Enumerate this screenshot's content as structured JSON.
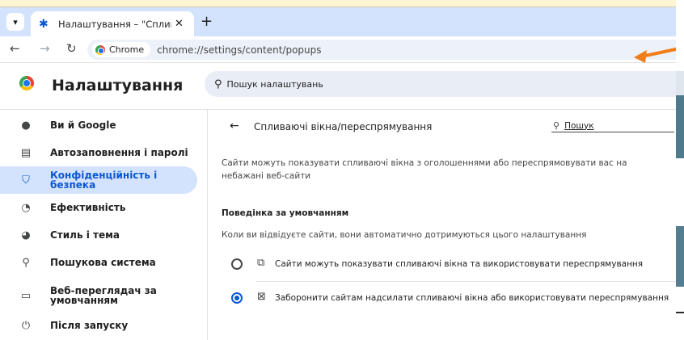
{
  "browser": {
    "tab_title": "Налаштування – \"Спливаючі в",
    "new_tab": "+",
    "chrome_chip": "Chrome",
    "url": "chrome://settings/content/popups"
  },
  "header": {
    "title": "Налаштування",
    "search_placeholder": "Пошук налаштувань"
  },
  "sidebar": {
    "items": [
      {
        "label": "Ви й Google",
        "icon": "person-icon"
      },
      {
        "label": "Автозаповнення і паролі",
        "icon": "clipboard-icon"
      },
      {
        "label": "Конфіденційність і безпека",
        "icon": "shield-icon",
        "active": true
      },
      {
        "label": "Ефективність",
        "icon": "speedometer-icon"
      },
      {
        "label": "Стиль і тема",
        "icon": "palette-icon"
      },
      {
        "label": "Пошукова система",
        "icon": "search-icon"
      },
      {
        "label": "Веб-переглядач за умовчанням",
        "icon": "browser-icon"
      },
      {
        "label": "Після запуску",
        "icon": "power-icon"
      }
    ]
  },
  "main": {
    "title": "Спливаючі вікна/переспрямування",
    "search_label": "Пошук",
    "description": "Сайти можуть показувати спливаючі вікна з оголошеннями або переспрямовувати вас на небажані веб-сайти",
    "section_title": "Поведінка за умовчанням",
    "section_note": "Коли ви відвідуєте сайти, вони автоматично дотримуються цього налаштування",
    "options": [
      {
        "label": "Сайти можуть показувати спливаючі вікна та використовувати переспрямування",
        "selected": false,
        "icon": "popup-allowed-icon"
      },
      {
        "label": "Заборонити сайтам надсилати спливаючі вікна або використовувати переспрямування",
        "selected": true,
        "icon": "popup-blocked-icon"
      }
    ]
  },
  "colors": {
    "accent": "#0b57d0",
    "tabbar": "#d3e3fd",
    "arrow": "#f07d1a"
  }
}
